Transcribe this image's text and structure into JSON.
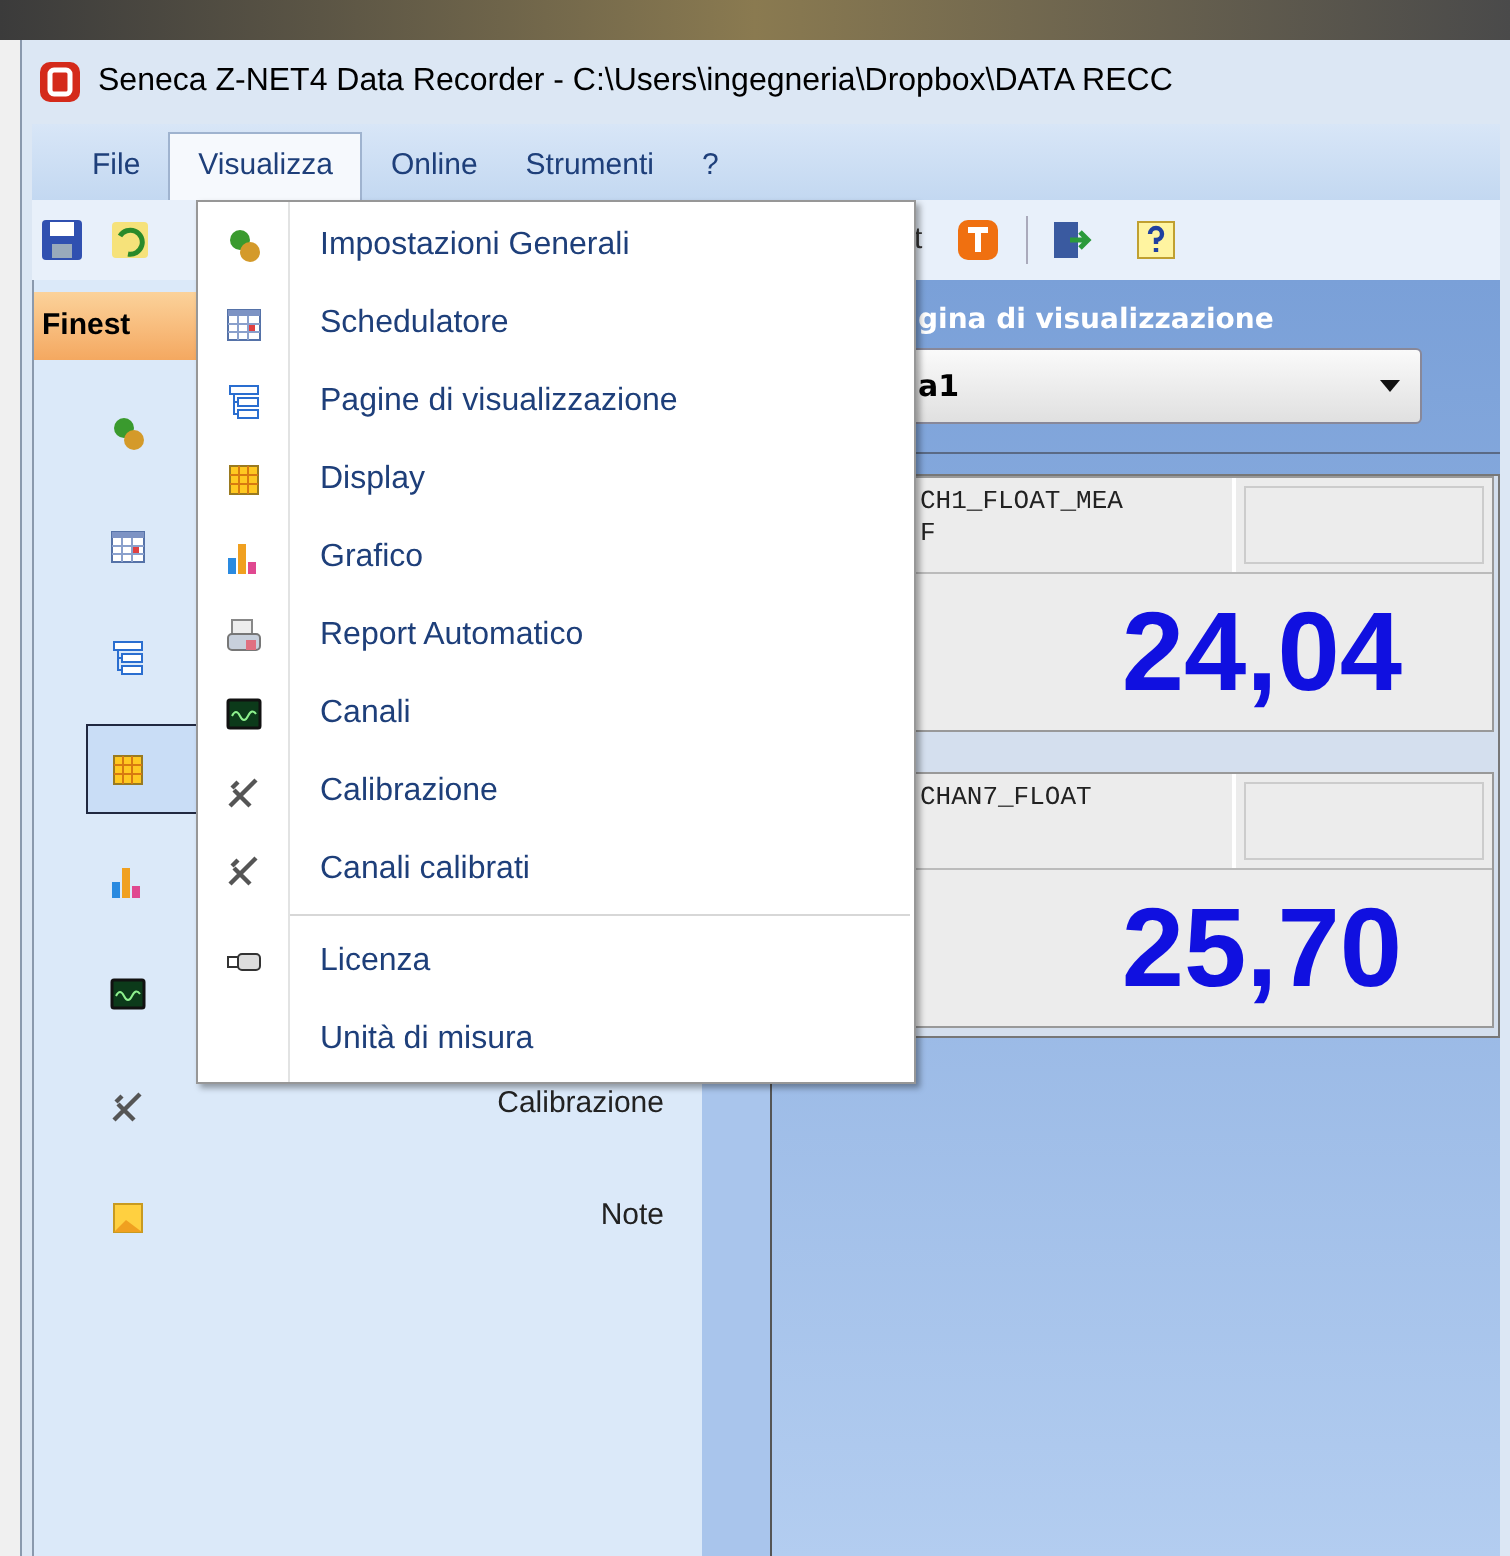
{
  "window": {
    "title": "Seneca Z-NET4 Data Recorder - C:\\Users\\ingegneria\\Dropbox\\DATA RECC"
  },
  "menubar": [
    {
      "label": "File",
      "selected": false
    },
    {
      "label": "Visualizza",
      "selected": true
    },
    {
      "label": "Online",
      "selected": false
    },
    {
      "label": "Strumenti",
      "selected": false
    },
    {
      "label": "?",
      "selected": false
    }
  ],
  "toolbar": {
    "partial_label": "t"
  },
  "sidebar": {
    "header": "Finest",
    "items": [
      {
        "selected": false
      },
      {
        "selected": false
      },
      {
        "selected": false
      },
      {
        "selected": true
      },
      {
        "selected": false
      },
      {
        "selected": false
      },
      {
        "label": "Calibrazione",
        "selected": false
      },
      {
        "label": "Note",
        "selected": false
      }
    ]
  },
  "main": {
    "header": "gina di visualizzazione",
    "page_select": {
      "value": "a1"
    },
    "displays": [
      {
        "label": "CH1_FLOAT_MEAF",
        "value": "24,04"
      },
      {
        "label": "CHAN7_FLOAT",
        "value": "25,70"
      }
    ]
  },
  "menu": {
    "groups": [
      [
        "Impostazioni Generali",
        "Schedulatore",
        "Pagine di visualizzazione",
        "Display",
        "Grafico",
        "Report Automatico",
        "Canali",
        "Calibrazione",
        "Canali calibrati"
      ],
      [
        "Licenza",
        "Unità di misura"
      ]
    ]
  }
}
